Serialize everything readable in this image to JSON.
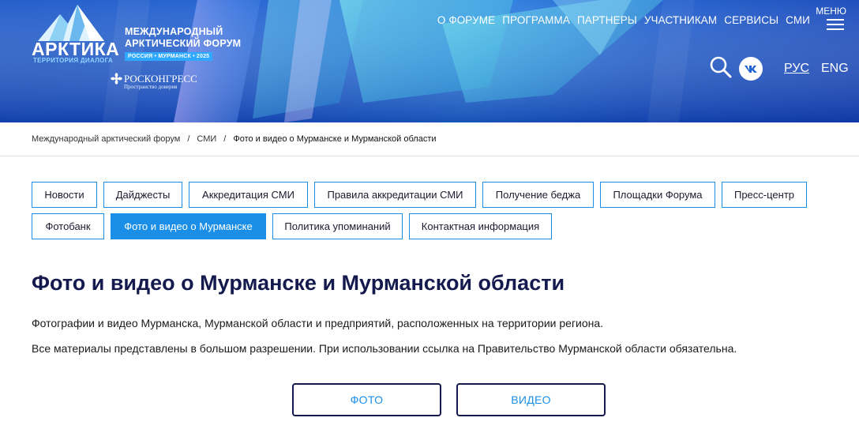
{
  "header": {
    "logo": {
      "title": "АРКТИКА",
      "subtitle": "ТЕРРИТОРИЯ ДИАЛОГА"
    },
    "forum_name_line1": "МЕЖДУНАРОДНЫЙ",
    "forum_name_line2": "АРКТИЧЕСКИЙ ФОРУМ",
    "forum_badge": "РОССИЯ • МУРМАНСК • 2025",
    "organizer": {
      "name": "РОСКОНГРЕСС",
      "tagline": "Пространство доверия"
    },
    "nav": [
      "О ФОРУМЕ",
      "ПРОГРАММА",
      "ПАРТНЕРЫ",
      "УЧАСТНИКАМ",
      "СЕРВИСЫ",
      "СМИ"
    ],
    "menu_label": "МЕНЮ",
    "languages": {
      "ru": "РУС",
      "en": "ENG"
    }
  },
  "breadcrumb": {
    "items": [
      "Международный арктический форум",
      "СМИ",
      "Фото и видео о Мурманске и Мурманской области"
    ],
    "separator": "/"
  },
  "tabs": [
    {
      "label": "Новости",
      "active": false
    },
    {
      "label": "Дайджесты",
      "active": false
    },
    {
      "label": "Аккредитация СМИ",
      "active": false
    },
    {
      "label": "Правила аккредитации СМИ",
      "active": false
    },
    {
      "label": "Получение беджа",
      "active": false
    },
    {
      "label": "Площадки Форума",
      "active": false
    },
    {
      "label": "Пресс-центр",
      "active": false
    },
    {
      "label": "Фотобанк",
      "active": false
    },
    {
      "label": "Фото и видео о Мурманске",
      "active": true
    },
    {
      "label": "Политика упоминаний",
      "active": false
    },
    {
      "label": "Контактная информация",
      "active": false
    }
  ],
  "main": {
    "title": "Фото и видео о Мурманске и Мурманской области",
    "paragraphs": [
      "Фотографии и видео Мурманска, Мурманской области и предприятий, расположенных на территории региона.",
      "Все материалы представлены в большом разрешении. При использовании ссылка на Правительство Мурманской области обязательна."
    ],
    "buttons": {
      "photo": "ФОТО",
      "video": "ВИДЕО"
    }
  },
  "colors": {
    "accent": "#1b8fe8",
    "title_navy": "#141a4e",
    "header_blue": "#1e5fd0"
  }
}
